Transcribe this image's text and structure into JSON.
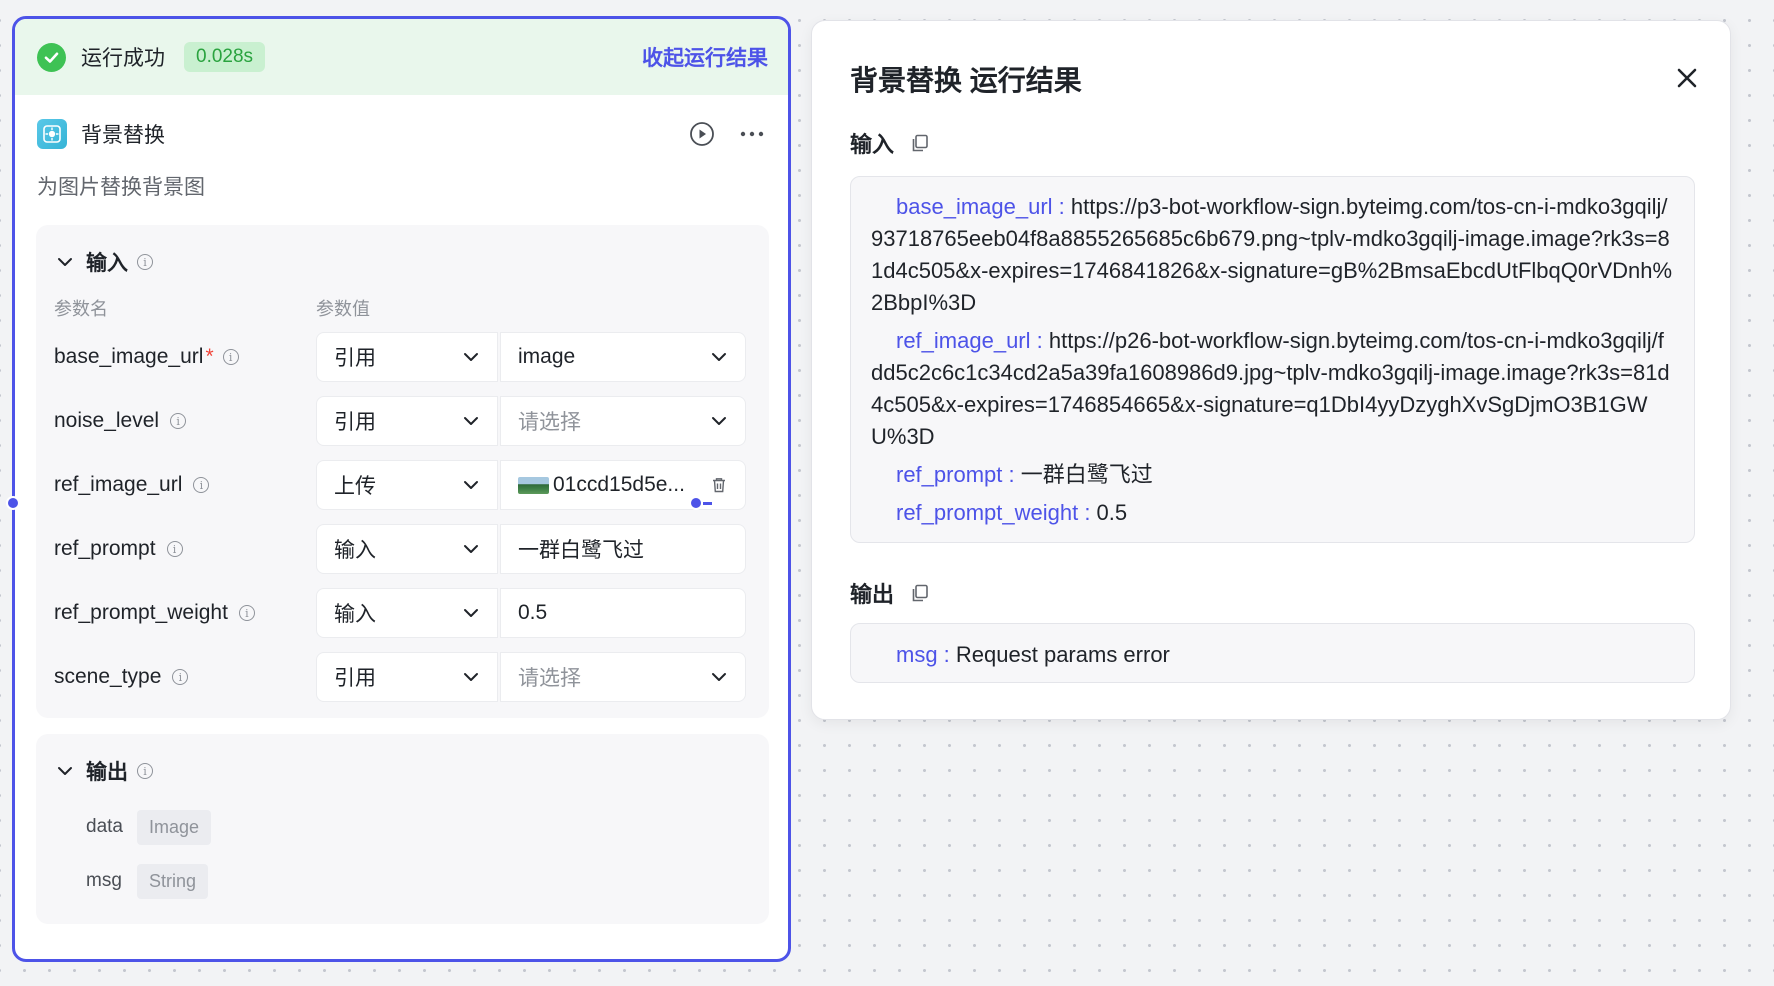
{
  "run": {
    "status": "运行成功",
    "duration": "0.028s",
    "collapse_label": "收起运行结果"
  },
  "node": {
    "title": "背景替换",
    "description": "为图片替换背景图",
    "icon": "image-edit-icon"
  },
  "inputs": {
    "title": "输入",
    "col_name": "参数名",
    "col_value": "参数值",
    "params": [
      {
        "name": "base_image_url",
        "required": "*",
        "type": "引用",
        "value": "image",
        "placeholder": false
      },
      {
        "name": "noise_level",
        "required": "",
        "type": "引用",
        "value": "请选择",
        "placeholder": true
      },
      {
        "name": "ref_image_url",
        "required": "",
        "type": "上传",
        "value": "01ccd15d5e...",
        "placeholder": false
      },
      {
        "name": "ref_prompt",
        "required": "",
        "type": "输入",
        "value": "一群白鹭飞过",
        "placeholder": false
      },
      {
        "name": "ref_prompt_weight",
        "required": "",
        "type": "输入",
        "value": "0.5",
        "placeholder": false
      },
      {
        "name": "scene_type",
        "required": "",
        "type": "引用",
        "value": "请选择",
        "placeholder": true
      }
    ]
  },
  "outputs": {
    "title": "输出",
    "fields": [
      {
        "name": "data",
        "type": "Image"
      },
      {
        "name": "msg",
        "type": "String"
      }
    ]
  },
  "result_panel": {
    "title": "背景替换 运行结果",
    "input_label": "输入",
    "output_label": "输出",
    "input_items": [
      {
        "key": "base_image_url : ",
        "value": "https://p3-bot-workflow-sign.byteimg.com/tos-cn-i-mdko3gqilj/93718765eeb04f8a8855265685c6b679.png~tplv-mdko3gqilj-image.image?rk3s=81d4c505&x-expires=1746841826&x-signature=gB%2BmsaEbcdUtFlbqQ0rVDnh%2BbpI%3D"
      },
      {
        "key": "ref_image_url : ",
        "value": "https://p26-bot-workflow-sign.byteimg.com/tos-cn-i-mdko3gqilj/fdd5c2c6c1c34cd2a5a39fa1608986d9.jpg~tplv-mdko3gqilj-image.image?rk3s=81d4c505&x-expires=1746854665&x-signature=q1DbI4yyDzyghXvSgDjmO3B1GWU%3D"
      },
      {
        "key": "ref_prompt : ",
        "value": "一群白鹭飞过"
      },
      {
        "key": "ref_prompt_weight : ",
        "value": "0.5"
      }
    ],
    "output_items": [
      {
        "key": "msg : ",
        "value": "Request params error"
      }
    ]
  },
  "colors": {
    "accent": "#4d53e8",
    "success": "#3ec254",
    "success_bg": "#e9f7ec",
    "required": "#f0453a"
  }
}
